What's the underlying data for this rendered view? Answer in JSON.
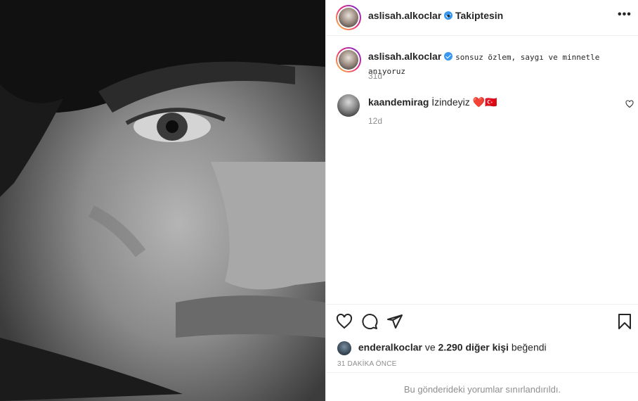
{
  "post": {
    "author": "aslisah.alkoclar",
    "follow_separator": "•",
    "follow_status": "Takiptesin",
    "more_label": "•••"
  },
  "caption": {
    "author": "aslisah.alkoclar",
    "text": "sonsuz özlem, saygı ve minnetle anıyoruz",
    "time": "31d"
  },
  "comments": [
    {
      "author": "kaandemirag",
      "text": "İzindeyiz",
      "emoji": "❤️🇹🇷",
      "time": "12d"
    }
  ],
  "likes": {
    "first_liker": "enderalkoclar",
    "connector": "ve",
    "others_count": "2.290 diğer kişi",
    "suffix": "beğendi"
  },
  "posted_ago": "31 DAKİKA ÖNCE",
  "comments_restricted": "Bu gönderideki yorumlar sınırlandırıldı.",
  "icons": [
    "like-icon",
    "comment-icon",
    "share-icon",
    "save-icon",
    "verified-icon",
    "more-options-icon"
  ],
  "colors": {
    "verified": "#3897f0",
    "heart": "#ed4956",
    "muted": "#8e8e8e",
    "text": "#262626"
  }
}
